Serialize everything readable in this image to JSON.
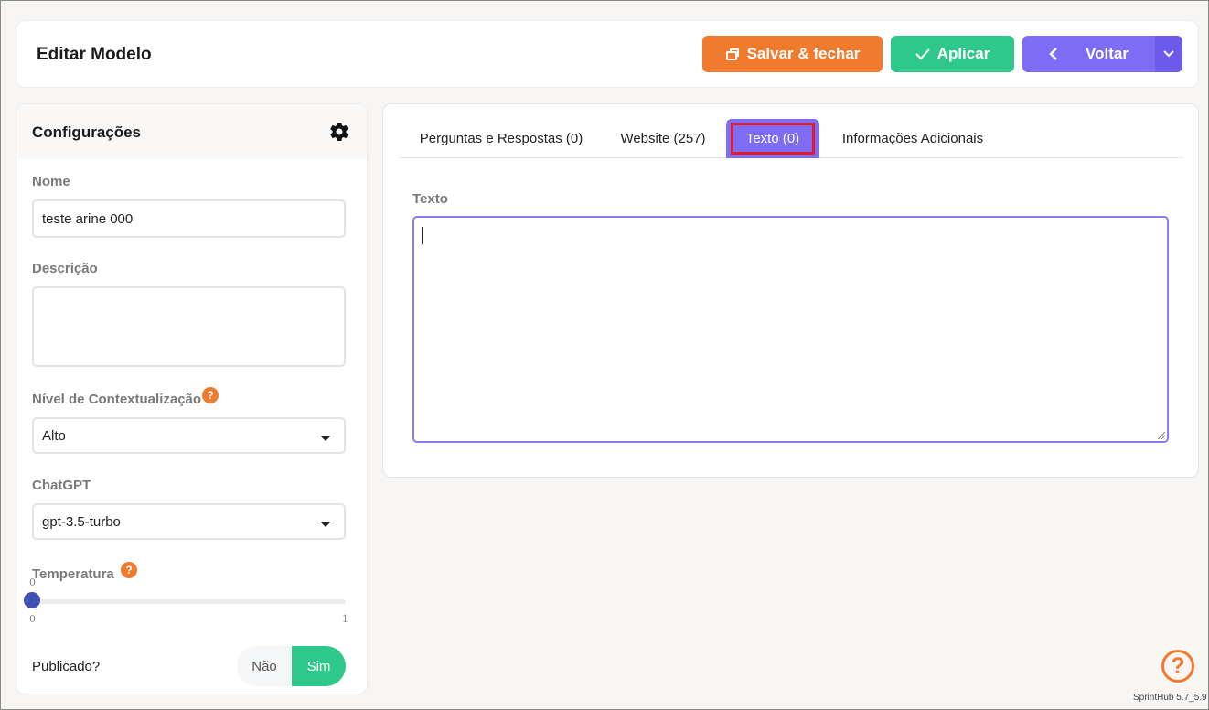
{
  "header": {
    "title": "Editar Modelo",
    "save_label": "Salvar & fechar",
    "apply_label": "Aplicar",
    "back_label": "Voltar"
  },
  "config": {
    "title": "Configurações",
    "name_label": "Nome",
    "name_value": "teste arine 000",
    "description_label": "Descrição",
    "description_value": "",
    "context_label": "Nível de Contextualização",
    "context_value": "Alto",
    "chatgpt_label": "ChatGPT",
    "chatgpt_value": "gpt-3.5-turbo",
    "temperature_label": "Temperatura",
    "temperature_value": "0",
    "temperature_min": "0",
    "temperature_max": "1",
    "published_label": "Publicado?",
    "published_no": "Não",
    "published_yes": "Sim",
    "published_selected": "Sim",
    "help_symbol": "?"
  },
  "tabs": [
    {
      "label": "Perguntas e Respostas (0)"
    },
    {
      "label": "Website (257)"
    },
    {
      "label": "Texto (0)",
      "active": true
    },
    {
      "label": "Informações Adicionais"
    }
  ],
  "text_panel": {
    "label": "Texto",
    "value": ""
  },
  "footer": {
    "help_symbol": "?",
    "version": "SprintHub 5.7_5.9"
  },
  "colors": {
    "orange": "#f07a2d",
    "green": "#2ec98a",
    "purple": "#7f6cf5",
    "slider": "#3f51b5",
    "highlight": "#e01b2c"
  }
}
